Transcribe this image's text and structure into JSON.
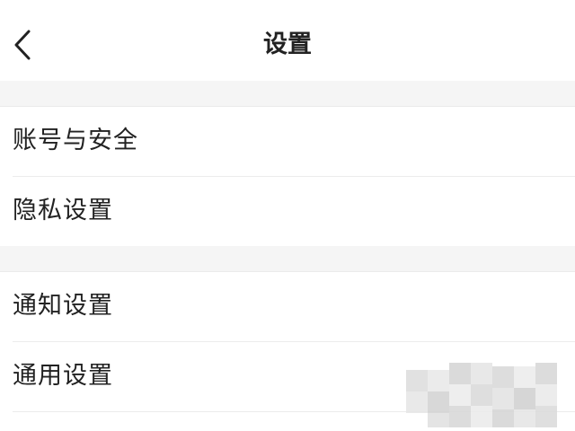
{
  "header": {
    "title": "设置",
    "back_icon": "chevron-left-icon"
  },
  "groups": [
    {
      "items": [
        {
          "label": "账号与安全"
        },
        {
          "label": "隐私设置"
        }
      ]
    },
    {
      "items": [
        {
          "label": "通知设置"
        },
        {
          "label": "通用设置"
        }
      ]
    }
  ],
  "colors": {
    "background": "#ffffff",
    "section_gap": "#f5f5f5",
    "text": "#222222",
    "divider": "#ececec"
  }
}
